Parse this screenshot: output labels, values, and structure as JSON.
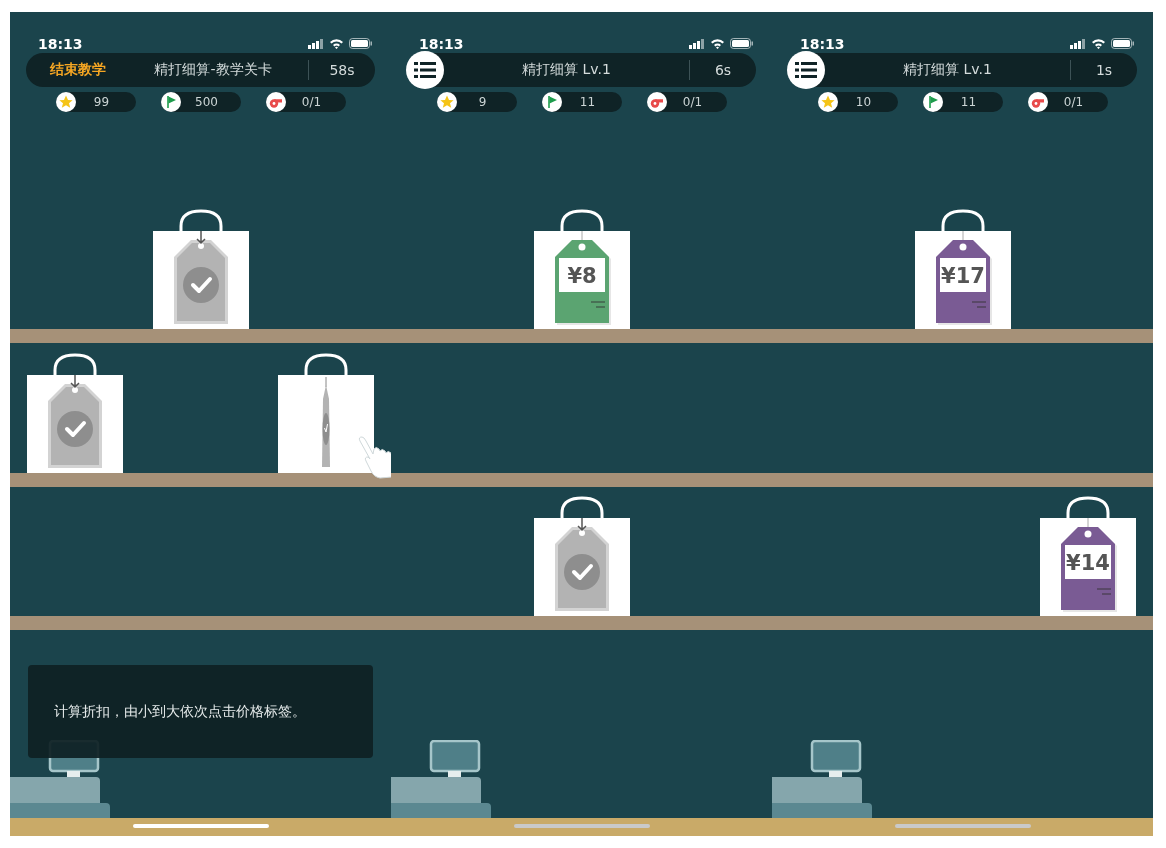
{
  "screens": [
    {
      "status_bar": {
        "time": "18:13"
      },
      "header": {
        "exit_button": "结束教学",
        "title": "精打细算-教学关卡",
        "timer": "58s"
      },
      "stats": [
        {
          "kind": "star",
          "value": "99"
        },
        {
          "kind": "flag",
          "value": "500"
        },
        {
          "kind": "whistle",
          "value": "0/1"
        }
      ],
      "top_shelf": {
        "center": {
          "pointer": false,
          "tag": {
            "kind": "done"
          }
        }
      },
      "middle_shelf": {
        "left": {
          "pointer": false,
          "tag": {
            "kind": "done"
          }
        },
        "right": {
          "pointer": true,
          "tag": {
            "kind": "turning"
          }
        }
      },
      "tip": "计算折扣，由小到大依次点击价格标签。"
    },
    {
      "status_bar": {
        "time": "18:13"
      },
      "header": {
        "title": "精打细算 Lv.1",
        "timer": "6s"
      },
      "stats": [
        {
          "kind": "star",
          "value": "9"
        },
        {
          "kind": "flag",
          "value": "11"
        },
        {
          "kind": "whistle",
          "value": "0/1"
        }
      ],
      "top_shelf": {
        "center": {
          "pointer": false,
          "tag": {
            "kind": "price",
            "price": "¥8",
            "color": "#5ba471"
          }
        }
      },
      "bottom_shelf": {
        "center": {
          "pointer": false,
          "tag": {
            "kind": "done"
          }
        }
      }
    },
    {
      "status_bar": {
        "time": "18:13"
      },
      "header": {
        "title": "精打细算 Lv.1",
        "timer": "1s"
      },
      "stats": [
        {
          "kind": "star",
          "value": "10"
        },
        {
          "kind": "flag",
          "value": "11"
        },
        {
          "kind": "whistle",
          "value": "0/1"
        }
      ],
      "top_shelf": {
        "center": {
          "pointer": false,
          "tag": {
            "kind": "price",
            "price": "¥17",
            "color": "#7a5b94"
          }
        }
      },
      "bottom_shelf": {
        "right": {
          "pointer": false,
          "tag": {
            "kind": "price",
            "price": "¥14",
            "color": "#7a5b94"
          }
        }
      }
    }
  ]
}
